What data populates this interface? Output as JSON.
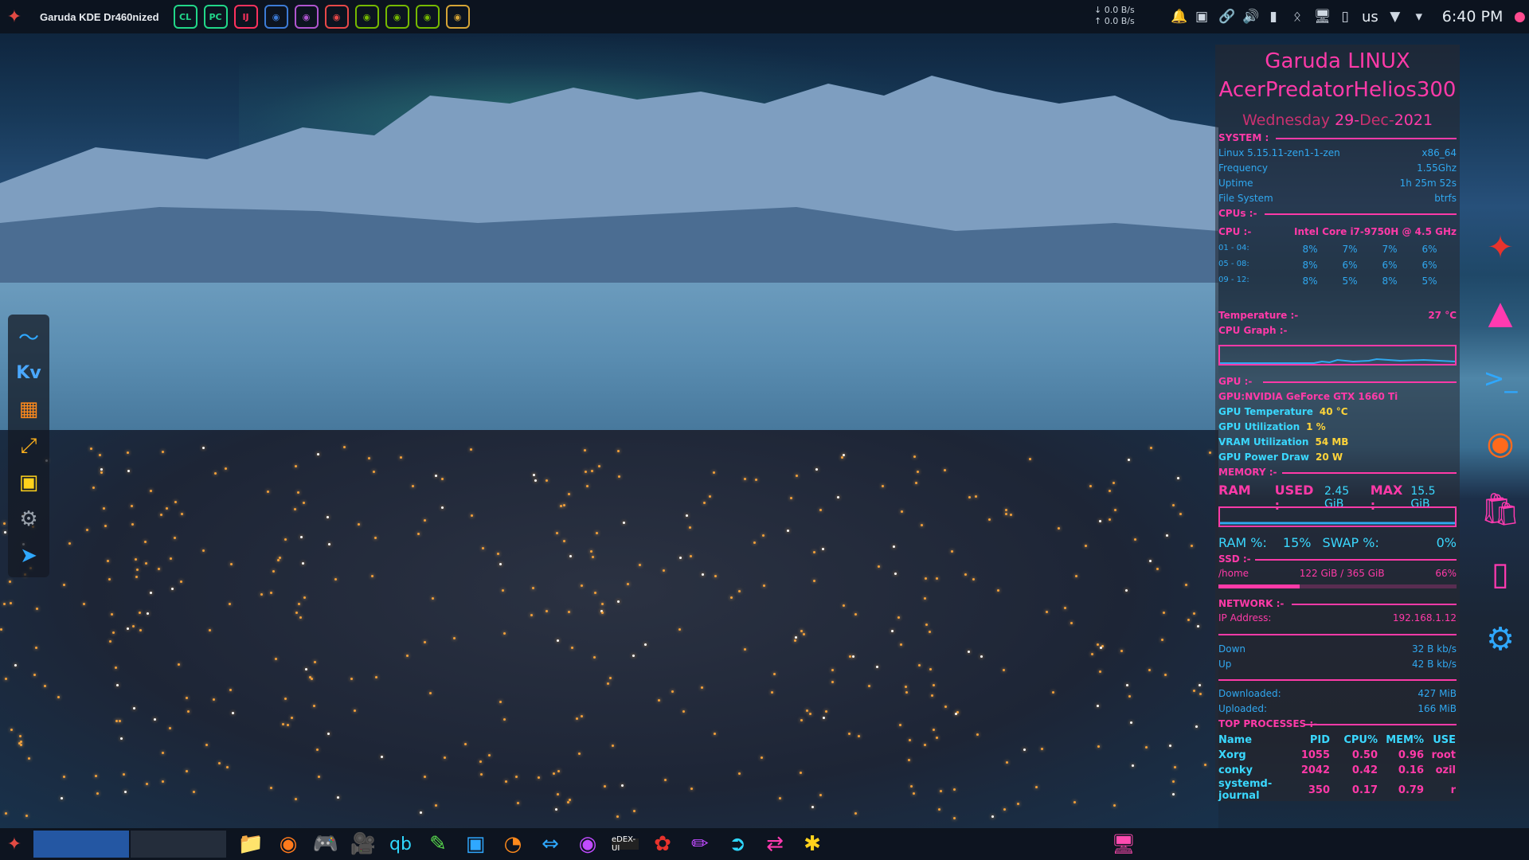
{
  "topbar": {
    "app_title": "Garuda KDE Dr460nized",
    "launchers": [
      {
        "name": "clion",
        "label": "CL",
        "color": "#21d789"
      },
      {
        "name": "pycharm",
        "label": "PC",
        "color": "#21d789"
      },
      {
        "name": "intellij",
        "label": "IJ",
        "color": "#fe315d"
      },
      {
        "name": "vscode",
        "label": "",
        "color": "#3c7bd6"
      },
      {
        "name": "github-desktop",
        "label": "",
        "color": "#b055d0"
      },
      {
        "name": "speedometer",
        "label": "",
        "color": "#e84848"
      },
      {
        "name": "nvidia-settings",
        "label": "",
        "color": "#76b900"
      },
      {
        "name": "nvidia-x",
        "label": "",
        "color": "#76b900"
      },
      {
        "name": "nvidia-panel",
        "label": "",
        "color": "#76b900"
      },
      {
        "name": "extension",
        "label": "",
        "color": "#d5a436"
      }
    ],
    "net_down": "0.0 B/s",
    "net_up": "0.0 B/s",
    "keyboard_layout": "us",
    "clock": "6:40 PM"
  },
  "conky": {
    "distro": "Garuda LINUX",
    "host": "AcerPredatorHelios300",
    "weekday": "Wednesday",
    "day": "29-",
    "month": "Dec-",
    "year": "2021",
    "system_label": "SYSTEM :",
    "kernel": "Linux 5.15.11-zen1-1-zen",
    "arch": "x86_64",
    "frequency_label": "Frequency",
    "frequency": "1.55Ghz",
    "uptime_label": "Uptime",
    "uptime": "1h 25m 52s",
    "fs_label": "File System",
    "fs": "btrfs",
    "cpus_label": "CPUs :-",
    "cpu_label": "CPU :-",
    "cpu_model": "Intel Core i7-9750H @ 4.5 GHz",
    "cpu_rows": [
      {
        "range": "01 - 04:",
        "vals": [
          "8%",
          "7%",
          "7%",
          "6%"
        ]
      },
      {
        "range": "05 - 08:",
        "vals": [
          "8%",
          "6%",
          "6%",
          "6%"
        ]
      },
      {
        "range": "09 - 12:",
        "vals": [
          "8%",
          "5%",
          "8%",
          "5%"
        ]
      }
    ],
    "temp_label": "Temperature :-",
    "temp": "27 °C",
    "cpu_graph_label": "CPU Graph  :-",
    "gpu_label": "GPU :-",
    "gpu_name": "GPU:NVIDIA GeForce GTX 1660 Ti",
    "gpu_temp_label": "GPU Temperature",
    "gpu_temp": "40 °C",
    "gpu_util_label": "GPU Utilization",
    "gpu_util": "1 %",
    "vram_label": "VRAM Utilization",
    "vram": "54 MB",
    "gpu_power_label": "GPU Power Draw",
    "gpu_power": "20 W",
    "memory_label": "MEMORY :-",
    "ram_label": "RAM",
    "used_label": "USED :",
    "used": "2.45 GiB",
    "max_label": "MAX :",
    "max": "15.5 GiB",
    "ram_pct_label": "RAM %:",
    "ram_pct": "15%",
    "swap_pct_label": "SWAP %:",
    "swap_pct": "0%",
    "ssd_label": "SSD :-",
    "home_label": "/home",
    "home_usage": "122 GiB / 365 GiB",
    "home_pct": "66%",
    "home_fill": 0.34,
    "network_label": "NETWORK :-",
    "ip_label": "IP Address:",
    "ip": "192.168.1.12",
    "down_label": "Down",
    "down": "32 B kb/s",
    "up_label": "Up",
    "up": "42 B kb/s",
    "downloaded_label": "Downloaded:",
    "downloaded": "427 MiB",
    "uploaded_label": "Uploaded:",
    "uploaded": "166 MiB",
    "top_label": "TOP PROCESSES :-",
    "proc_headers": [
      "Name",
      "PID",
      "CPU%",
      "MEM%",
      "USE"
    ],
    "processes": [
      [
        "Xorg",
        "1055",
        "0.50",
        "0.96",
        "root"
      ],
      [
        "conky",
        "2042",
        "0.42",
        "0.16",
        "ozil"
      ],
      [
        "systemd-journal",
        "350",
        "0.17",
        "0.79",
        "r"
      ]
    ]
  },
  "left_dock": [
    "wavemon-icon",
    "kdenlive-icon",
    "virtualbox-icon",
    "resize-icon",
    "network-icon",
    "predator-icon",
    "rocket-icon"
  ],
  "right_dock": [
    "garuda-icon",
    "store-icon",
    "terminal-icon",
    "dragon-icon",
    "bag-icon",
    "kde-connect-icon",
    "settings-icon"
  ],
  "taskbar_apps": [
    "folder-icon",
    "chrome-icon",
    "gamepad-icon",
    "camera-icon",
    "qbittorrent-icon",
    "syringe-icon",
    "disk-icon",
    "pie-icon",
    "teamviewer-icon",
    "obs-icon",
    "edex-icon",
    "raspberry-icon",
    "pen-icon",
    "share-icon",
    "transfer-icon",
    "pineapple-icon"
  ],
  "taskbar_edex_label": "eDEX-UI"
}
